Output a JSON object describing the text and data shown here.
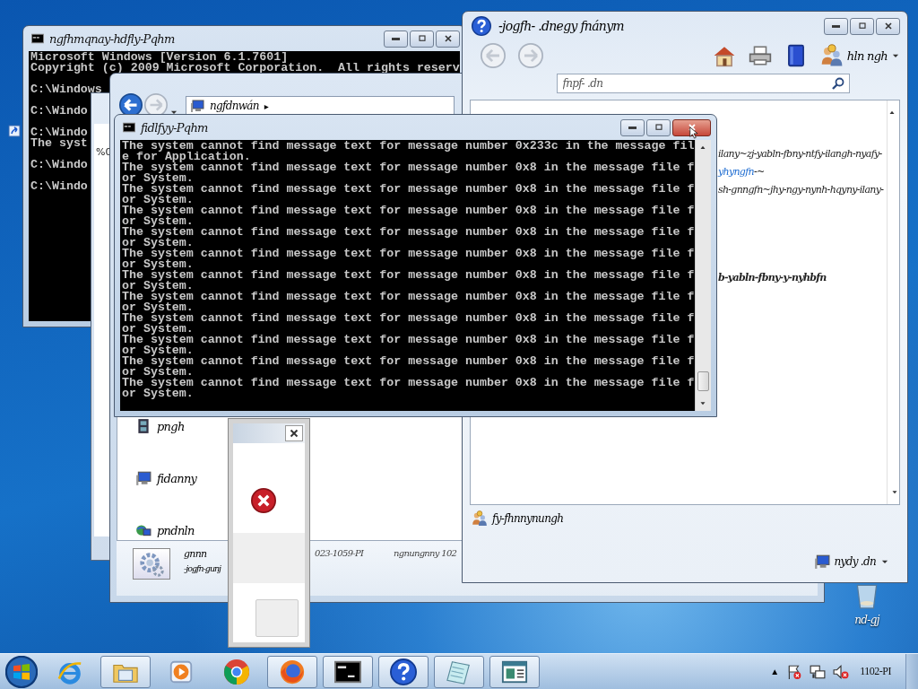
{
  "back_console": {
    "title": "ngfhmqnay-hdfly-Pqhm",
    "lines": [
      {
        "kind": "text",
        "text": "Microsoft Windows [Version 6.1.7601]"
      },
      {
        "kind": "text",
        "text": "Copyright (c) 2009 Microsoft Corporation.  All rights reserv"
      },
      {
        "kind": "blank"
      },
      {
        "kind": "text",
        "text": "C:\\Windows"
      },
      {
        "kind": "blank"
      },
      {
        "kind": "text",
        "text": "C:\\Windo"
      },
      {
        "kind": "blank"
      },
      {
        "kind": "text",
        "text": "C:\\Windo"
      },
      {
        "kind": "text",
        "text": "The syst"
      },
      {
        "kind": "blank"
      },
      {
        "kind": "text",
        "text": "C:\\Windo"
      },
      {
        "kind": "blank"
      },
      {
        "kind": "text",
        "text": "C:\\Windo"
      }
    ]
  },
  "side_window": {
    "text": "%0"
  },
  "explorer": {
    "nav": [
      {
        "kind": "back",
        "disabled": false
      },
      {
        "kind": "forward",
        "disabled": true
      }
    ],
    "address": "ngfdnwán",
    "address_arrow": "▸",
    "sidebar": [
      {
        "kind": "film",
        "label": "pngh"
      },
      {
        "kind": "computer",
        "label": "fidanny"
      },
      {
        "kind": "globe",
        "label": "pndnln"
      }
    ],
    "details": {
      "name": "gnnn",
      "subtitle": "-jogfn-gunj",
      "date": "023-1059-PI",
      "meta": "ngnungnny 102"
    }
  },
  "help": {
    "title": "-jogfh- .dnegy fnánym",
    "nav": [
      {
        "kind": "back",
        "disabled": true
      },
      {
        "kind": "forward",
        "disabled": true
      }
    ],
    "menu": "hln ngh",
    "search": {
      "placeholder": "fnpf- .dn"
    },
    "content": [
      {
        "kind": "text",
        "text": "ilany~zj-yabln-fbny-ntfy-ilangh-nyafy-"
      },
      {
        "kind": "link",
        "link": "yhyngfn",
        "text": "-~"
      },
      {
        "kind": "text",
        "text": "sh-gnngfn~jhy-ngy-nynh-hqyny-ilany-"
      },
      {
        "kind": "heading",
        "text": "b-yabln-fbny-y-nyhbfn"
      }
    ],
    "footer_link": "fy-fhnnynungh",
    "connection": "nydy .dn"
  },
  "front_console": {
    "title": "fidlfyy-Pqhm",
    "lines": [
      "The system cannot find message text for message number 0x233c in the message fil",
      "e for Application.",
      "The system cannot find message text for message number 0x8 in the message file f",
      "or System.",
      "The system cannot find message text for message number 0x8 in the message file f",
      "or System.",
      "The system cannot find message text for message number 0x8 in the message file f",
      "or System.",
      "The system cannot find message text for message number 0x8 in the message file f",
      "or System.",
      "The system cannot find message text for message number 0x8 in the message file f",
      "or System.",
      "The system cannot find message text for message number 0x8 in the message file f",
      "or System.",
      "The system cannot find message text for message number 0x8 in the message file f",
      "or System.",
      "The system cannot find message text for message number 0x8 in the message file f",
      "or System.",
      "The system cannot find message text for message number 0x8 in the message file f",
      "or System.",
      "The system cannot find message text for message number 0x8 in the message file f",
      "or System.",
      "The system cannot find message text for message number 0x8 in the message file f",
      "or System."
    ]
  },
  "desktop": {
    "recycle_bin": "nd-gj"
  },
  "taskbar": {
    "items": [
      {
        "kind": "ie",
        "running": false
      },
      {
        "kind": "explorer",
        "running": true
      },
      {
        "kind": "media",
        "running": false
      },
      {
        "kind": "chrome",
        "running": false
      },
      {
        "kind": "firefox",
        "running": true
      },
      {
        "kind": "console",
        "running": true
      },
      {
        "kind": "help",
        "running": true
      },
      {
        "kind": "notepad",
        "running": true
      },
      {
        "kind": "window",
        "running": true
      }
    ],
    "tray": [
      {
        "kind": "expand",
        "text": "▲"
      },
      {
        "kind": "flag"
      },
      {
        "kind": "network"
      },
      {
        "kind": "volume"
      }
    ],
    "clock": "1102-PI"
  }
}
